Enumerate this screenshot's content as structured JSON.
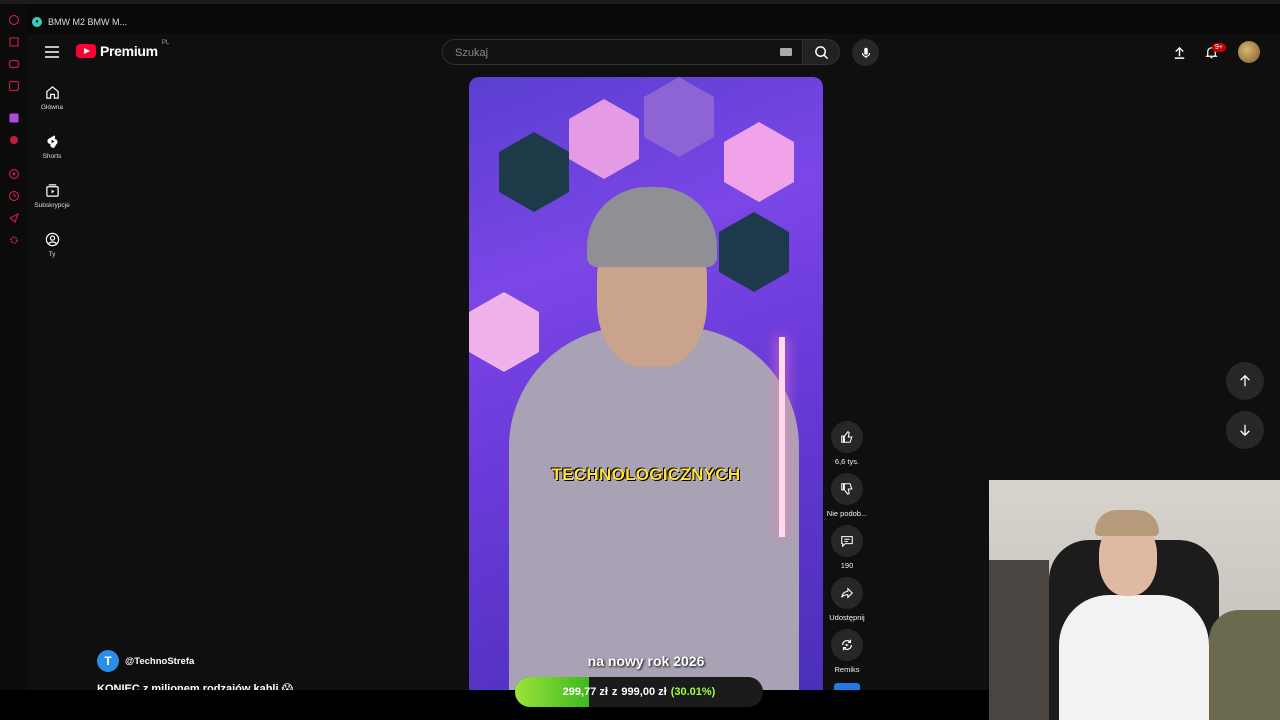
{
  "browser": {
    "tab_title": "BMW M2 BMW M..."
  },
  "header": {
    "logo_text": "Premium",
    "region": "PL",
    "search_placeholder": "Szukaj",
    "notification_count": "9+"
  },
  "guide": {
    "items": [
      {
        "label": "Główna",
        "icon": "home-icon"
      },
      {
        "label": "Shorts",
        "icon": "shorts-icon"
      },
      {
        "label": "Subskrypcje",
        "icon": "subscriptions-icon"
      },
      {
        "label": "Ty",
        "icon": "account-icon"
      }
    ]
  },
  "short": {
    "caption_top": "TECHNOLOGICZNYCH",
    "caption_bottom": "na nowy rok 2026",
    "channel": "@TechnoStrefa",
    "channel_initial": "T",
    "title": "KONIEC z milionem rodzajów kabli 😱"
  },
  "actions": {
    "likes": "6,6 tys.",
    "dislike": "Nie podob...",
    "comments": "190",
    "share": "Udostępnij",
    "remix": "Remiks"
  },
  "donation_goal": {
    "current": "299,77 zł",
    "separator": "z",
    "target": "999,00 zł",
    "percent_text": "(30.01%)",
    "progress": 0.3001
  },
  "colors": {
    "background": "#0f0f0f",
    "brand_red": "#ff0033",
    "goal_green": "#9be33a"
  }
}
